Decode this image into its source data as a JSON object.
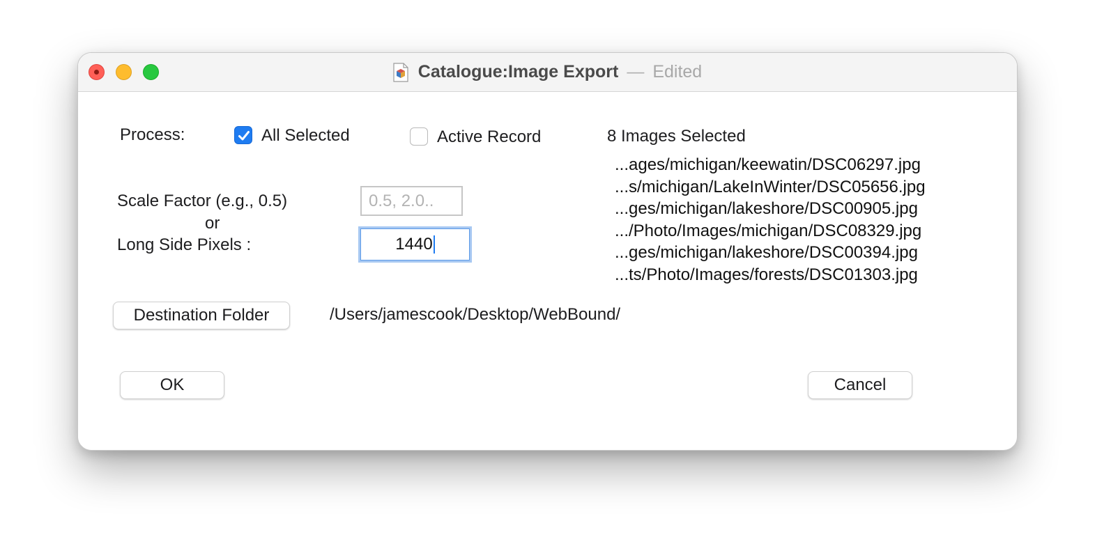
{
  "window": {
    "title": "Catalogue:Image Export",
    "separator": "—",
    "status": "Edited"
  },
  "process": {
    "label": "Process:",
    "all_selected": {
      "label": "All Selected",
      "checked": true
    },
    "active_record": {
      "label": "Active Record",
      "checked": false
    }
  },
  "selection_summary": "8 Images Selected",
  "files": [
    "...ages/michigan/keewatin/DSC06297.jpg",
    "...s/michigan/LakeInWinter/DSC05656.jpg",
    "...ges/michigan/lakeshore/DSC00905.jpg",
    ".../Photo/Images/michigan/DSC08329.jpg",
    "...ges/michigan/lakeshore/DSC00394.jpg",
    "...ts/Photo/Images/forests/DSC01303.jpg"
  ],
  "scale": {
    "label": "Scale Factor (e.g., 0.5)",
    "or_label": "or",
    "placeholder": "0.5,  2.0..",
    "value": ""
  },
  "pixels": {
    "label": "Long Side Pixels :",
    "value": "1440"
  },
  "destination": {
    "button_label": "Destination Folder",
    "path": "/Users/jamescook/Desktop/WebBound/"
  },
  "buttons": {
    "ok": "OK",
    "cancel": "Cancel"
  },
  "colors": {
    "accent": "#1f7cf1",
    "close": "#ff5f57",
    "minimize": "#febc2e",
    "zoom": "#28c840"
  },
  "icons": {
    "document": "document-icon",
    "checkmark": "checkmark-icon"
  }
}
